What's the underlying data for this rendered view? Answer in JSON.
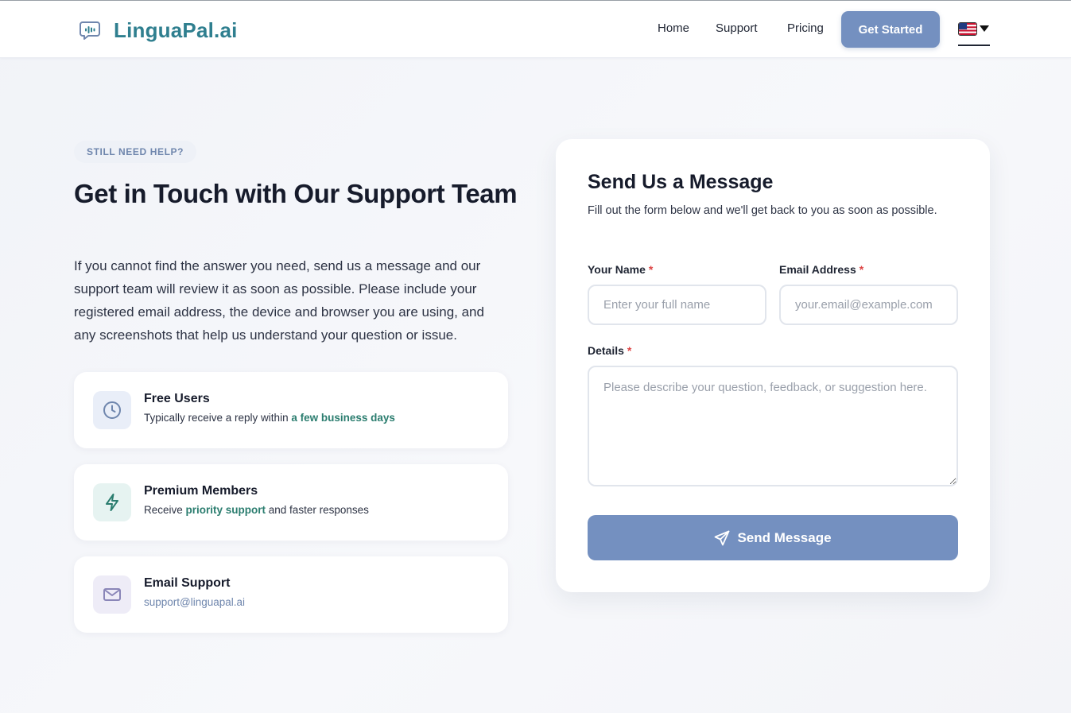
{
  "brand": {
    "name": "LinguaPal.ai",
    "icon": "speech-bubble-icon"
  },
  "nav": {
    "items": [
      "Home",
      "Support",
      "Pricing"
    ],
    "cta_label": "Get Started",
    "language_icon": "us-flag-icon"
  },
  "hero": {
    "eyebrow": "STILL NEED HELP?",
    "title": "Get in Touch with Our Support Team",
    "description": "If you cannot find the answer you need, send us a message and our support team will review it as soon as possible. Please include your registered email address, the device and browser you are using, and any screenshots that help us understand your question or issue."
  },
  "cards": [
    {
      "title": "Free Users",
      "text_before": "Typically receive a reply within ",
      "highlight": "a few business days",
      "text_after": "",
      "icon": "clock-icon"
    },
    {
      "title": "Premium Members",
      "text_before": "Receive ",
      "highlight": "priority support",
      "text_after": " and faster responses",
      "icon": "lightning-icon"
    },
    {
      "title": "Email Support",
      "link": "support@linguapal.ai",
      "icon": "mail-icon"
    }
  ],
  "form": {
    "title": "Send Us a Message",
    "subtitle": "Fill out the form below and we'll get back to you as soon as possible.",
    "name_label": "Your Name",
    "name_placeholder": "Enter your full name",
    "email_label": "Email Address",
    "email_placeholder": "your.email@example.com",
    "details_label": "Details",
    "details_placeholder": "Please describe your question, feedback, or suggestion here.",
    "required_marker": "*",
    "submit_label": "Send Message",
    "submit_icon": "paper-plane-icon"
  },
  "colors": {
    "brand": "#2f7f8f",
    "accent": "#7490c0",
    "highlight_green": "#2b7d6f",
    "required": "#dd4444"
  }
}
